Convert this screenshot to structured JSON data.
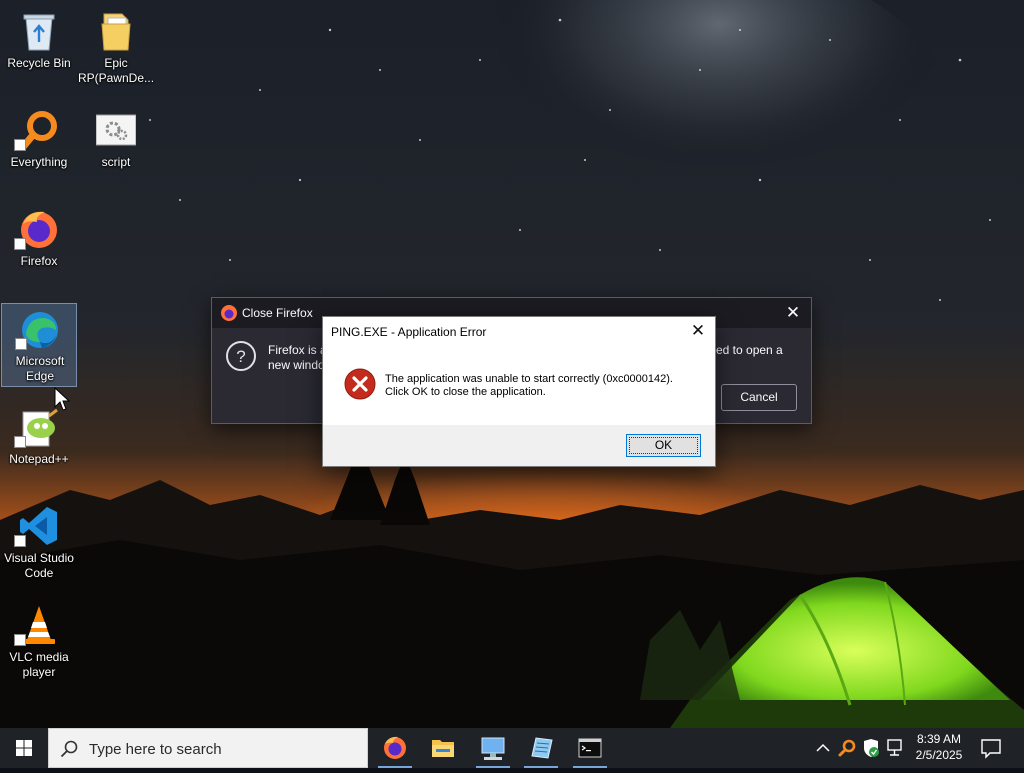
{
  "desktop_icons": [
    {
      "name": "recycle-bin",
      "label_lines": [
        "Recycle Bin"
      ]
    },
    {
      "name": "epic-rp",
      "label_lines": [
        "Epic",
        "RP(PawnDe..."
      ]
    },
    {
      "name": "everything",
      "label_lines": [
        "Everything"
      ]
    },
    {
      "name": "script",
      "label_lines": [
        "script"
      ]
    },
    {
      "name": "firefox",
      "label_lines": [
        "Firefox"
      ]
    },
    {
      "name": "microsoft-edge",
      "label_lines": [
        "Microsoft",
        "Edge"
      ],
      "selected": true
    },
    {
      "name": "notepad-plus-plus",
      "label_lines": [
        "Notepad++"
      ]
    },
    {
      "name": "visual-studio-code",
      "label_lines": [
        "Visual Studio",
        "Code"
      ]
    },
    {
      "name": "vlc-media-player",
      "label_lines": [
        "VLC media",
        "player"
      ]
    }
  ],
  "firefox_dialog": {
    "title": "Close Firefox",
    "message_line1": "Firefox is a",
    "message_line2": "new windo",
    "message_right": "sed to open a",
    "cancel_label": "Cancel"
  },
  "error_dialog": {
    "title": "PING.EXE - Application Error",
    "message_line1": "The application was unable to start correctly (0xc0000142).",
    "message_line2": "Click OK to close the application.",
    "ok_label": "OK",
    "icon": "error-x-icon"
  },
  "taskbar": {
    "search_placeholder": "Type here to search",
    "pinned": [
      "firefox",
      "file-explorer",
      "network-computer",
      "notepad",
      "command-prompt"
    ],
    "clock_time": "8:39 AM",
    "clock_date": "2/5/2025"
  },
  "colors": {
    "taskbar_bg": "#1f2226",
    "firefox_dialog_bg": "#2b2a33",
    "error_red": "#c42b1c",
    "focus_blue": "#0078d7"
  }
}
